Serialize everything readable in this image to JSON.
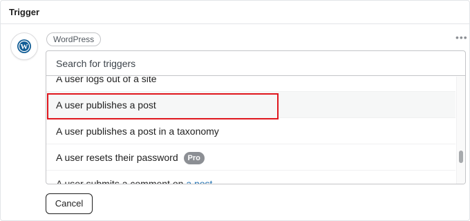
{
  "section": {
    "title": "Trigger"
  },
  "integration": {
    "name": "WordPress",
    "icon": "wordpress-icon"
  },
  "search": {
    "placeholder": "Search for triggers"
  },
  "triggers": [
    {
      "label": "A user logs out of a site"
    },
    {
      "label": "A user publishes a post",
      "selected": true
    },
    {
      "label": "A user publishes a post in a taxonomy"
    },
    {
      "label": "A user resets their password",
      "badge": "Pro"
    },
    {
      "label": "A user submits a comment on ",
      "link": "a post"
    }
  ],
  "actions": {
    "cancel_label": "Cancel",
    "more_icon": "more-options-icon"
  },
  "colors": {
    "highlight": "#e0161d",
    "link": "#2271b1",
    "badge": "#8c8f94"
  }
}
